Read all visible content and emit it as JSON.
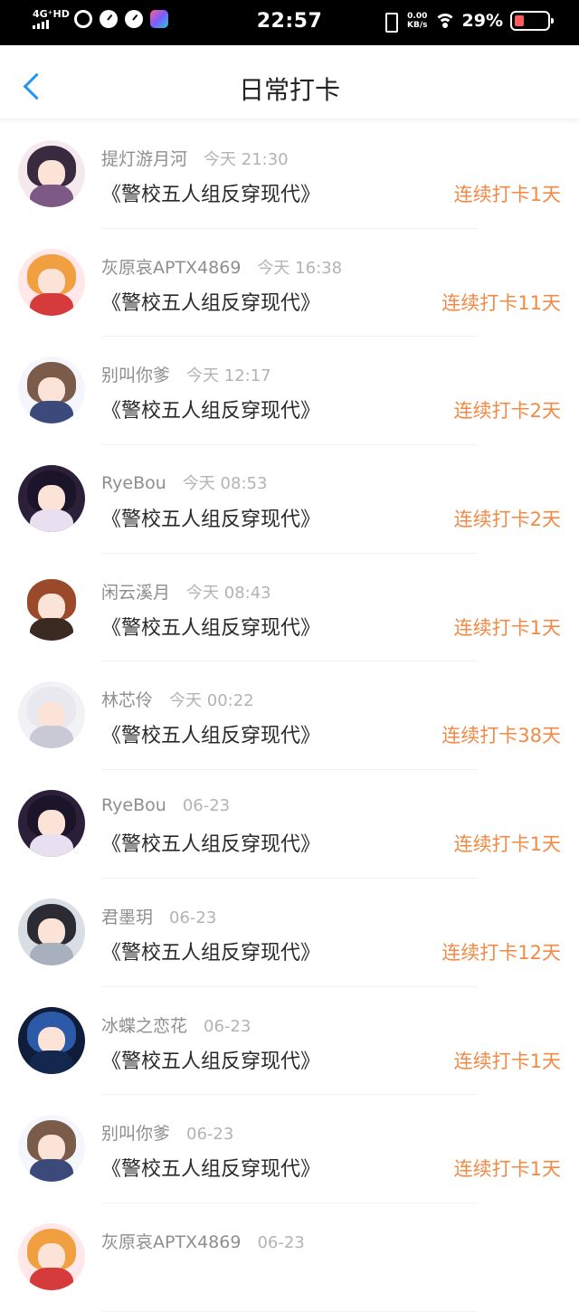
{
  "status_bar": {
    "network": "4G⁺HD",
    "time": "22:57",
    "speed_value": "0.00",
    "speed_unit": "KB/s",
    "battery_pct": "29%",
    "battery_level": 0.29,
    "accent_low_battery": "#ff5a5a"
  },
  "header": {
    "back_icon": "chevron-left-icon",
    "title": "日常打卡",
    "accent": "#2196f3"
  },
  "colors": {
    "streak": "#f28a45",
    "username": "#8e8e8e",
    "time": "#b3b3b3"
  },
  "entries": [
    {
      "username": "提灯游月河",
      "time": "今天 21:30",
      "book": "《警校五人组反穿现代》",
      "streak": "连续打卡1天"
    },
    {
      "username": "灰原哀APTX4869",
      "time": "今天 16:38",
      "book": "《警校五人组反穿现代》",
      "streak": "连续打卡11天"
    },
    {
      "username": "别叫你爹",
      "time": "今天 12:17",
      "book": "《警校五人组反穿现代》",
      "streak": "连续打卡2天"
    },
    {
      "username": "RyeBou",
      "time": "今天 08:53",
      "book": "《警校五人组反穿现代》",
      "streak": "连续打卡2天"
    },
    {
      "username": "闲云溪月",
      "time": "今天 08:43",
      "book": "《警校五人组反穿现代》",
      "streak": "连续打卡1天"
    },
    {
      "username": "林芯伶",
      "time": "今天 00:22",
      "book": "《警校五人组反穿现代》",
      "streak": "连续打卡38天"
    },
    {
      "username": "RyeBou",
      "time": "06-23",
      "book": "《警校五人组反穿现代》",
      "streak": "连续打卡1天"
    },
    {
      "username": "君墨玥",
      "time": "06-23",
      "book": "《警校五人组反穿现代》",
      "streak": "连续打卡12天"
    },
    {
      "username": "冰蝶之恋花",
      "time": "06-23",
      "book": "《警校五人组反穿现代》",
      "streak": "连续打卡1天"
    },
    {
      "username": "别叫你爹",
      "time": "06-23",
      "book": "《警校五人组反穿现代》",
      "streak": "连续打卡1天"
    },
    {
      "username": "灰原哀APTX4869",
      "time": "06-23",
      "book": "",
      "streak": ""
    }
  ]
}
